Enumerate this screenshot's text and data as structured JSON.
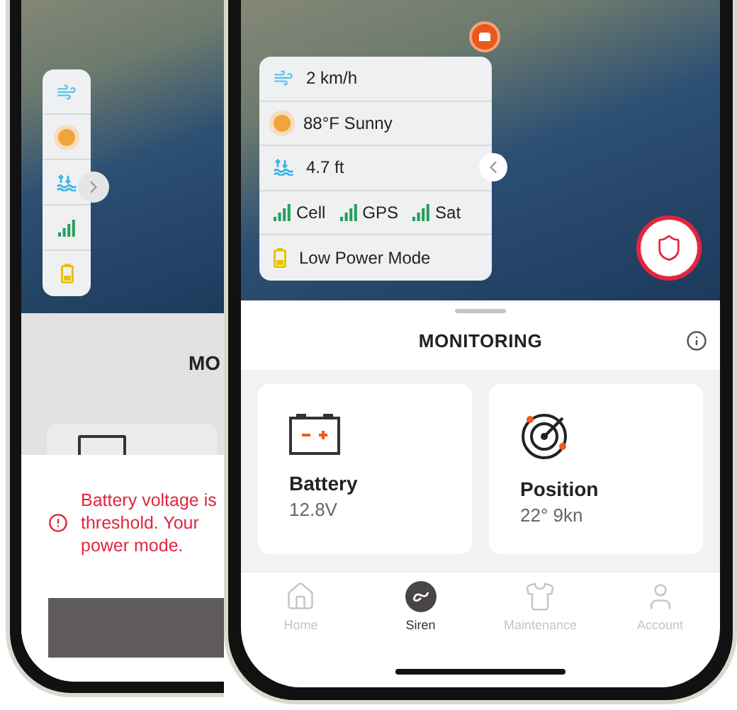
{
  "left_phone": {
    "panel": [
      {
        "kind": "wind"
      },
      {
        "kind": "weather"
      },
      {
        "kind": "tide"
      },
      {
        "kind": "signal"
      },
      {
        "kind": "power"
      }
    ],
    "title": "MO",
    "alert": {
      "lines": [
        "Battery voltage is",
        "threshold. Your",
        "power mode."
      ]
    }
  },
  "right_phone": {
    "panel": [
      {
        "kind": "wind",
        "text": "2 km/h"
      },
      {
        "kind": "weather",
        "text": "88°F Sunny"
      },
      {
        "kind": "tide",
        "text": "4.7 ft"
      },
      {
        "kind": "signals",
        "items": [
          "Cell",
          "GPS",
          "Sat"
        ]
      },
      {
        "kind": "power",
        "text": "Low Power Mode"
      }
    ],
    "title": "MONITORING",
    "cards": [
      {
        "kind": "battery",
        "label": "Battery",
        "value": "12.8V"
      },
      {
        "kind": "position",
        "label": "Position",
        "value": "22° 9kn"
      }
    ],
    "tabs": [
      {
        "kind": "home",
        "label": "Home",
        "selected": false
      },
      {
        "kind": "siren",
        "label": "Siren",
        "selected": true
      },
      {
        "kind": "maintenance",
        "label": "Maintenance",
        "selected": false
      },
      {
        "kind": "account",
        "label": "Account",
        "selected": false
      }
    ]
  }
}
